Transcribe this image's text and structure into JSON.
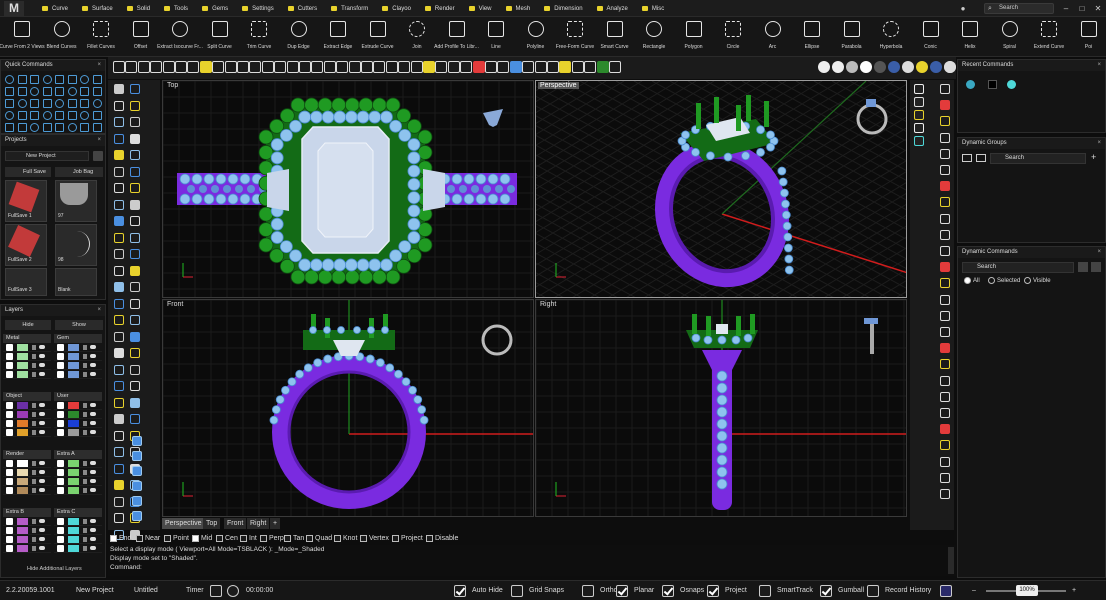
{
  "app": {
    "logo": "M"
  },
  "menu": {
    "tabs": [
      "Curve",
      "Surface",
      "Solid",
      "Tools",
      "Gems",
      "Settings",
      "Cutters",
      "Transform",
      "Clayoo",
      "Render",
      "View",
      "Mesh",
      "Dimension",
      "Analyze",
      "Misc"
    ],
    "search_placeholder": "Search",
    "window_buttons": [
      "–",
      "□",
      "✕"
    ]
  },
  "ribbon": {
    "tools": [
      "Curve From 2 Views",
      "Blend Curves",
      "Fillet Curves",
      "Offset",
      "Extract Isocurve Fr...",
      "Split Curve",
      "Trim Curve",
      "Dup Edge",
      "Extract Edge",
      "Extrude Curve",
      "Join",
      "Add Profile To Libr...",
      "Line",
      "Polyline",
      "Free-Form Curve",
      "Smart Curve",
      "Rectangle",
      "Polygon",
      "Circle",
      "Arc",
      "Ellipse",
      "Parabola",
      "Hyperbola",
      "Conic",
      "Helix",
      "Spiral",
      "Extend Curve",
      "Poi"
    ]
  },
  "quick_commands": {
    "title": "Quick Commands",
    "close": "×"
  },
  "projects": {
    "title": "Projects",
    "close": "×",
    "project_select": "New Project",
    "buttons": [
      "Full Save",
      "Job Bag"
    ],
    "tiles": [
      "FullSave 1",
      "97",
      "FullSave 2",
      "98",
      "FullSave 3",
      "Blank"
    ]
  },
  "layers": {
    "title": "Layers",
    "close": "×",
    "hide_label": "Hide",
    "show_label": "Show",
    "groups": [
      {
        "name": "Metal",
        "colors": [
          "#9fe0a0",
          "#9fe0a0",
          "#9fe0a0",
          "#9fe0a0"
        ]
      },
      {
        "name": "Gem",
        "colors": [
          "#6f97d6",
          "#6f97d6",
          "#6f97d6",
          "#6f97d6"
        ]
      },
      {
        "name": "Object",
        "colors": [
          "#6a2fa5",
          "#9a3bb5",
          "#e07b2a",
          "#e0a02a"
        ]
      },
      {
        "name": "User",
        "colors": [
          "#e33b3b",
          "#2c8a2c",
          "#1a3fd6",
          "#9a9a9a"
        ]
      },
      {
        "name": "Render",
        "colors": [
          "#ffffff",
          "#e9d9b0",
          "#c9a97a",
          "#b08a5a"
        ]
      },
      {
        "name": "Extra A",
        "colors": [
          "#7ad36f",
          "#7ad36f",
          "#7ad36f",
          "#7ad36f"
        ]
      },
      {
        "name": "Extra B",
        "colors": [
          "#b65cc7",
          "#b65cc7",
          "#b65cc7",
          "#b65cc7"
        ]
      },
      {
        "name": "Extra C",
        "colors": [
          "#4ed8d8",
          "#4ed8d8",
          "#4ed8d8",
          "#4ed8d8"
        ]
      }
    ],
    "footer": "Hide Additional Layers"
  },
  "viewports": {
    "top": "Top",
    "perspective": "Perspective",
    "front": "Front",
    "right": "Right"
  },
  "view_tabs": [
    "Perspective",
    "Top",
    "Front",
    "Right",
    "+"
  ],
  "osnaps": [
    {
      "label": "End",
      "on": true
    },
    {
      "label": "Near",
      "on": false
    },
    {
      "label": "Point",
      "on": false
    },
    {
      "label": "Mid",
      "on": true
    },
    {
      "label": "Cen",
      "on": false
    },
    {
      "label": "Int",
      "on": false
    },
    {
      "label": "Perp",
      "on": false
    },
    {
      "label": "Tan",
      "on": false
    },
    {
      "label": "Quad",
      "on": false
    },
    {
      "label": "Knot",
      "on": false
    },
    {
      "label": "Vertex",
      "on": false
    },
    {
      "label": "Project",
      "on": false
    },
    {
      "label": "Disable",
      "on": false
    }
  ],
  "command": {
    "history": [
      "Select a display mode ( Viewport=All  Mode=TSBLACK ): _Mode=_Shaded",
      "Display mode set to \"Shaded\"."
    ],
    "prompt": "Command:"
  },
  "right_panels": {
    "recent_commands": "Recent Commands",
    "dynamic_groups": "Dynamic Groups",
    "dynamic_groups_search": "Search",
    "dynamic_commands": "Dynamic Commands",
    "dynamic_commands_search": "Search",
    "filters": [
      "All",
      "Selected",
      "Visible"
    ],
    "close": "×",
    "add": "+"
  },
  "status": {
    "version": "2.2.20059.1001",
    "project": "New Project",
    "file": "Untitled",
    "timer_label": "Timer",
    "timer_value": "00:00:00",
    "toggles": [
      {
        "label": "Auto Hide",
        "on": true
      },
      {
        "label": "Grid Snaps",
        "on": false
      },
      {
        "label": "Ortho",
        "on": false
      },
      {
        "label": "Planar",
        "on": true
      },
      {
        "label": "Osnaps",
        "on": true
      },
      {
        "label": "Project",
        "on": true
      },
      {
        "label": "SmartTrack",
        "on": false
      },
      {
        "label": "Gumball",
        "on": true
      },
      {
        "label": "Record History",
        "on": false
      }
    ],
    "zoom": "100%"
  }
}
